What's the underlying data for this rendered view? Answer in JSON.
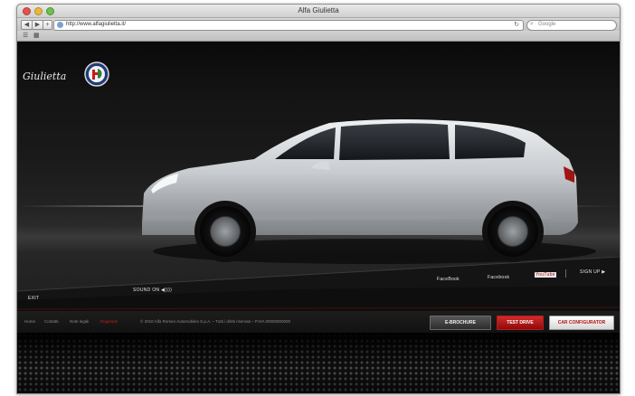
{
  "window": {
    "title": "Alfa Giulietta"
  },
  "toolbar": {
    "url": "http://www.alfagiulietta.it/",
    "search_placeholder": "Google"
  },
  "site": {
    "logo_text": "Giulietta"
  },
  "nav": {
    "left_label": "EXIT",
    "center_label": "SOUND ON  ◀))))",
    "social": [
      "FaceBook",
      "Facebook",
      "YouTube"
    ],
    "signup_label": "SIGN UP ▶"
  },
  "footer": {
    "links": [
      "Home",
      "Contatti",
      "Note legali",
      "Registrati"
    ],
    "legal": "© 2010 Alfa Romeo Automobiles S.p.A. – Tutti i diritti riservati – P.IVA 00000000000",
    "buttons": {
      "brochure": "E-BROCHURE",
      "test_drive": "TEST DRIVE",
      "configurator": "CAR CONFIGURATOR"
    }
  },
  "colors": {
    "accent_red": "#c41d1d",
    "car_silver": "#c9ccd0"
  }
}
